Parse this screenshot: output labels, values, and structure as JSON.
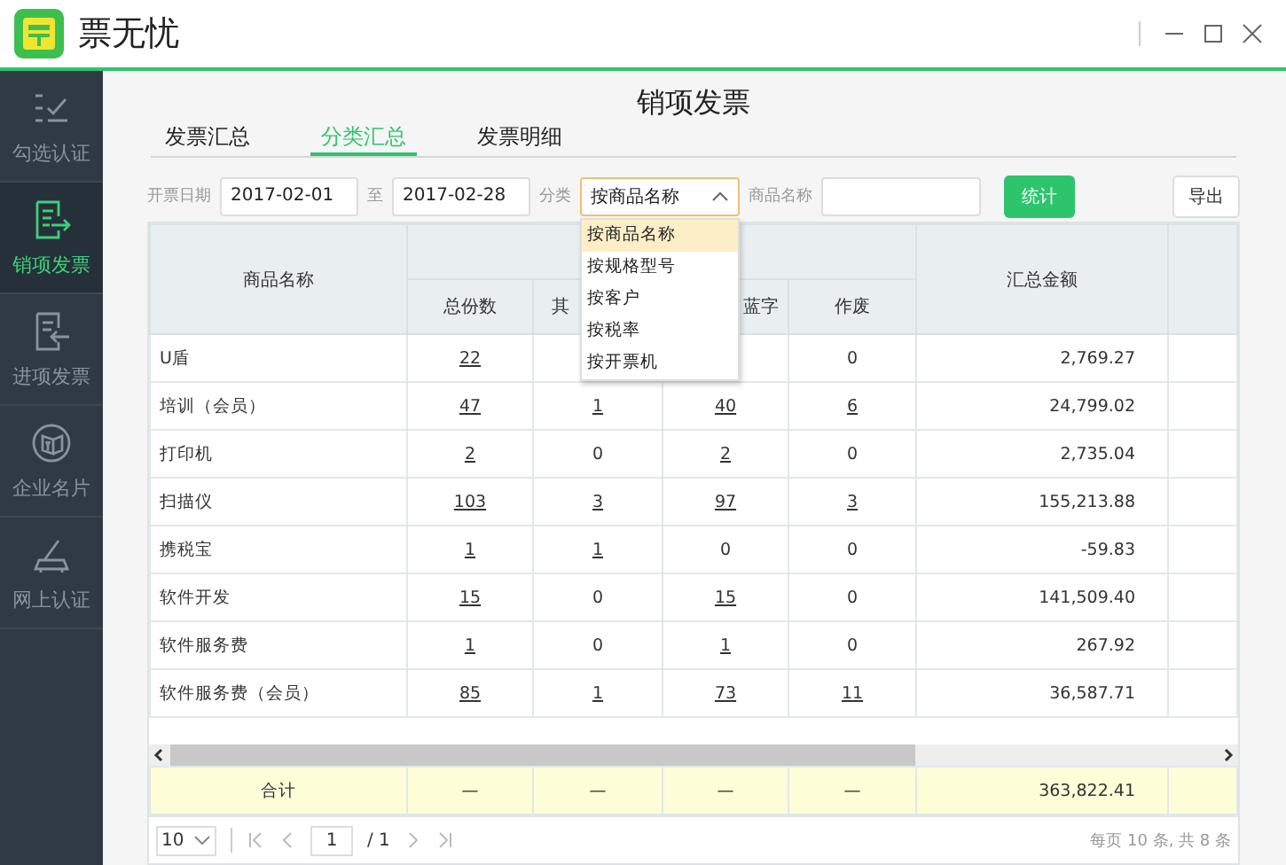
{
  "app": {
    "name": "票无忧"
  },
  "sidebar": {
    "items": [
      {
        "label": "勾选认证",
        "selected": false
      },
      {
        "label": "销项发票",
        "selected": true
      },
      {
        "label": "进项发票",
        "selected": false
      },
      {
        "label": "企业名片",
        "selected": false
      },
      {
        "label": "网上认证",
        "selected": false
      }
    ]
  },
  "page_title": "销项发票",
  "tabs": [
    {
      "label": "发票汇总",
      "selected": false
    },
    {
      "label": "分类汇总",
      "selected": true
    },
    {
      "label": "发票明细",
      "selected": false
    }
  ],
  "filters": {
    "date_label": "开票日期",
    "date_from": "2017-02-01",
    "to_label": "至",
    "date_to": "2017-02-28",
    "category_label": "分类",
    "category_value": "按商品名称",
    "name_label": "商品名称",
    "stat_button": "统计",
    "export_button": "导出"
  },
  "dropdown": {
    "options": [
      {
        "label": "按商品名称",
        "selected": true
      },
      {
        "label": "按规格型号",
        "selected": false
      },
      {
        "label": "按客户",
        "selected": false
      },
      {
        "label": "按税率",
        "selected": false
      },
      {
        "label": "按开票机",
        "selected": false
      }
    ]
  },
  "table": {
    "columns": [
      "商品名称",
      "总份数",
      "其",
      "蓝字",
      "作废",
      "汇总金额"
    ],
    "rows": [
      {
        "cells": [
          "U盾",
          {
            "text": "22",
            "link": true
          },
          null,
          null,
          "0",
          "2,769.27"
        ]
      },
      {
        "cells": [
          "培训（会员）",
          {
            "text": "47",
            "link": true
          },
          {
            "text": "1",
            "link": true
          },
          {
            "text": "40",
            "link": true
          },
          {
            "text": "6",
            "link": true
          },
          "24,799.02"
        ]
      },
      {
        "cells": [
          "打印机",
          {
            "text": "2",
            "link": true
          },
          "0",
          {
            "text": "2",
            "link": true
          },
          "0",
          "2,735.04"
        ]
      },
      {
        "cells": [
          "扫描仪",
          {
            "text": "103",
            "link": true
          },
          {
            "text": "3",
            "link": true
          },
          {
            "text": "97",
            "link": true
          },
          {
            "text": "3",
            "link": true
          },
          "155,213.88"
        ]
      },
      {
        "cells": [
          "携税宝",
          {
            "text": "1",
            "link": true
          },
          {
            "text": "1",
            "link": true
          },
          "0",
          "0",
          "-59.83"
        ]
      },
      {
        "cells": [
          "软件开发",
          {
            "text": "15",
            "link": true
          },
          "0",
          {
            "text": "15",
            "link": true
          },
          "0",
          "141,509.40"
        ]
      },
      {
        "cells": [
          "软件服务费",
          {
            "text": "1",
            "link": true
          },
          "0",
          {
            "text": "1",
            "link": true
          },
          "0",
          "267.92"
        ]
      },
      {
        "cells": [
          "软件服务费（会员）",
          {
            "text": "85",
            "link": true
          },
          {
            "text": "1",
            "link": true
          },
          {
            "text": "73",
            "link": true
          },
          {
            "text": "11",
            "link": true
          },
          "36,587.71"
        ]
      }
    ],
    "total": {
      "cells": [
        "合计",
        "—",
        "—",
        "—",
        "—",
        "363,822.41"
      ]
    }
  },
  "pager": {
    "page_size": "10",
    "page": "1",
    "pages": "/ 1",
    "summary": "每页 10 条, 共 8 条"
  }
}
